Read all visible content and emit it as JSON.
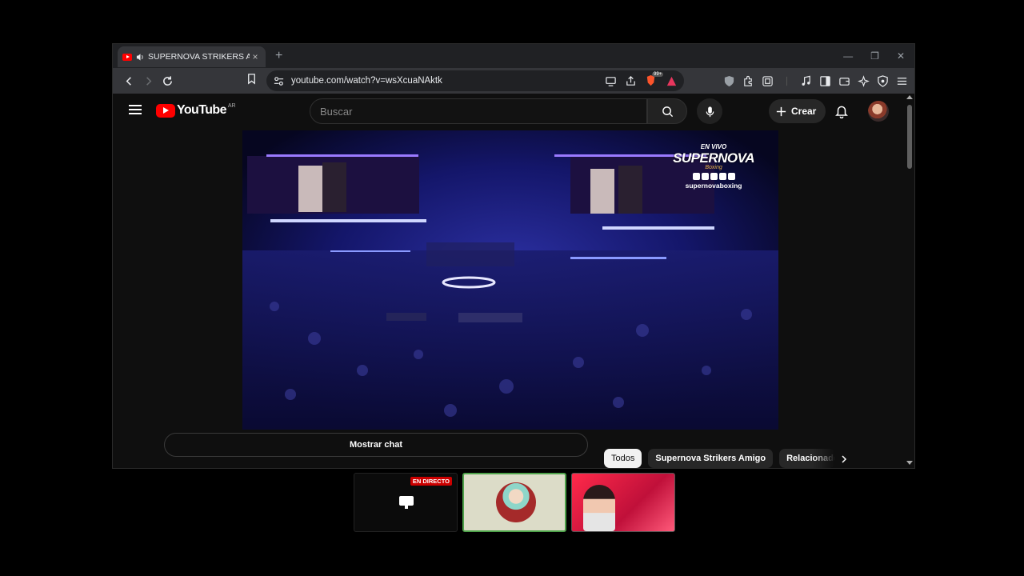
{
  "browser": {
    "tab": {
      "title": "SUPERNOVA STRIKERS AMIGO",
      "close_label": "×"
    },
    "new_tab_label": "+",
    "window_controls": {
      "minimize": "—",
      "restore": "❐",
      "close": "✕"
    },
    "url": "youtube.com/watch?v=wsXcuaNAktk",
    "brave_badge": "99+"
  },
  "youtube": {
    "logo_text": "YouTube",
    "country_code": "AR",
    "search_placeholder": "Buscar",
    "create_label": "Crear",
    "video_overlay": {
      "live_label": "EN VIVO",
      "brand": "SUPERNOVA",
      "sub": "Boxing",
      "handle": "supernovaboxing"
    },
    "chat_button": "Mostrar chat",
    "chips": [
      "Todos",
      "Supernova Strikers Amigo",
      "Relacionados"
    ]
  },
  "taskbar": {
    "live_badge": "EN DIRECTO"
  }
}
